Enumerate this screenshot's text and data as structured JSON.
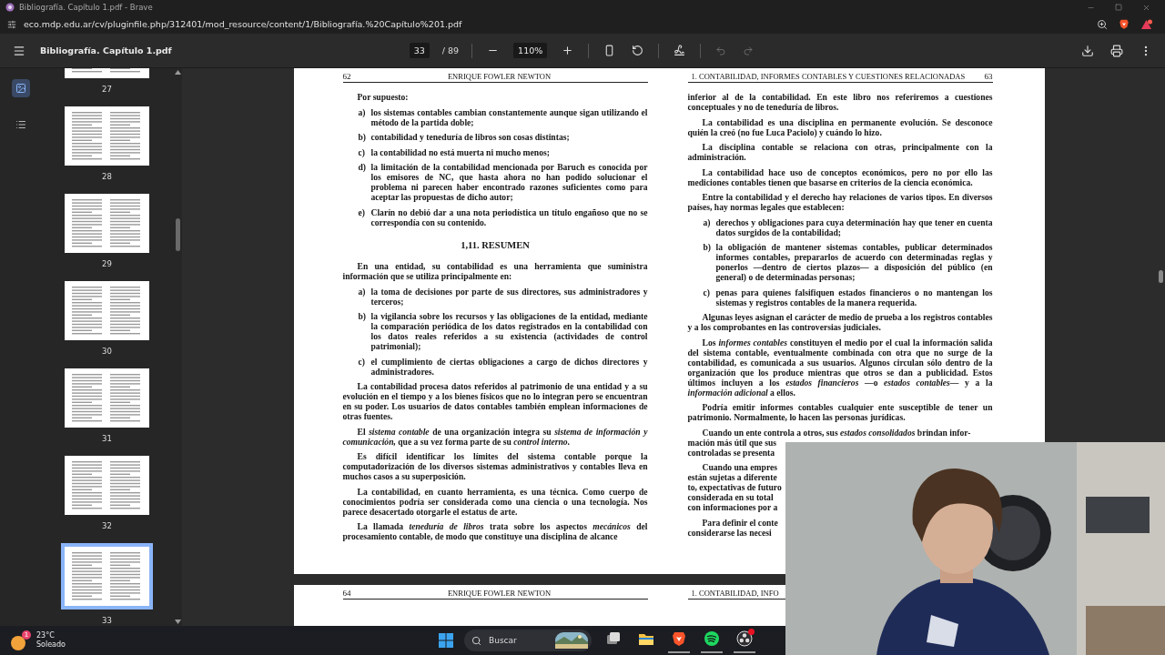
{
  "browser": {
    "title": "Bibliografía. Capítulo 1.pdf - Brave",
    "url": "eco.mdp.edu.ar/cv/pluginfile.php/312401/mod_resource/content/1/Bibliografía.%20Capítulo%201.pdf"
  },
  "toolbar": {
    "file_name": "Bibliografía. Capítulo 1.pdf",
    "page": "33",
    "page_total": "/ 89",
    "zoom": "110%",
    "history": [
      {
        "kind": "undo",
        "disabled": true
      },
      {
        "kind": "redo",
        "disabled": true
      }
    ]
  },
  "sidebar": {
    "tabs": [
      {
        "kind": "thumbnails",
        "selected": true
      },
      {
        "kind": "outline",
        "selected": false
      }
    ],
    "thumbnails": [
      {
        "label": "27",
        "selected": false
      },
      {
        "label": "28",
        "selected": false
      },
      {
        "label": "29",
        "selected": false
      },
      {
        "label": "30",
        "selected": false
      },
      {
        "label": "31",
        "selected": false
      },
      {
        "label": "32",
        "selected": false
      },
      {
        "label": "33",
        "selected": true
      }
    ]
  },
  "sheets": [
    {
      "left": {
        "number": "62",
        "header": "ENRIQUE FOWLER NEWTON",
        "blocks": [
          {
            "kind": "para",
            "text": "Por supuesto:"
          },
          {
            "kind": "item",
            "label": "a)",
            "text": "los sistemas contables cambian constantemente aunque sigan utilizando el método de la partida doble;"
          },
          {
            "kind": "item",
            "label": "b)",
            "text": "contabilidad y teneduría de libros son cosas distintas;"
          },
          {
            "kind": "item",
            "label": "c)",
            "text": "la contabilidad no está muerta ni mucho menos;"
          },
          {
            "kind": "item",
            "label": "d)",
            "text": "la limitación de la contabilidad mencionada por Baruch es conocida por los emisores de NC, que hasta ahora no han podido solucionar el problema ni parecen haber encontrado razones suficientes como para aceptar las propuestas de dicho autor;"
          },
          {
            "kind": "item",
            "label": "e)",
            "text": "Clarín no debió dar a una nota periodística un título engañoso que no se correspondía con su contenido."
          },
          {
            "kind": "heading",
            "text": "1,11. RESUMEN"
          },
          {
            "kind": "para",
            "text": "En una entidad, su contabilidad es una herramienta que suministra información que se utiliza principalmente en:"
          },
          {
            "kind": "item",
            "label": "a)",
            "text": "la toma de decisiones por parte de sus directores, sus administradores y terceros;"
          },
          {
            "kind": "item",
            "label": "b)",
            "text": "la vigilancia sobre los recursos y las obligaciones de la entidad, mediante la comparación periódica de los datos registrados en la contabilidad con los datos reales referidos a su existencia (actividades de control patrimonial);"
          },
          {
            "kind": "item",
            "label": "c)",
            "text": "el cumplimiento de ciertas obligaciones a cargo de dichos directores y administradores."
          },
          {
            "kind": "para",
            "text": "La contabilidad procesa datos referidos al patrimonio de una entidad y a su evolución en el tiempo y a los bienes físicos que no lo integran pero se encuentran en su poder. Los usuarios de datos contables también emplean informaciones de otras fuentes."
          },
          {
            "kind": "para",
            "text": "El *sistema contable* de una organización integra su *sistema de información y comunicación,* que a su vez forma parte de su *control interno*."
          },
          {
            "kind": "para",
            "text": "Es difícil identificar los límites del sistema contable porque la computadorización de los diversos sistemas administrativos y contables lleva en muchos casos a su superposición."
          },
          {
            "kind": "para",
            "text": "La contabilidad, en cuanto herramienta, es una técnica. Como cuerpo de conocimientos podría ser considerada como una ciencia o una tecnología. Nos parece desacertado otorgarle el estatus de arte."
          },
          {
            "kind": "para",
            "text": "La llamada *teneduría de libros* trata sobre los aspectos *mecánicos* del procesamiento contable, de modo que constituye una disciplina de alcance"
          }
        ]
      },
      "right": {
        "number": "63",
        "header": "1. CONTABILIDAD, INFORMES CONTABLES Y CUESTIONES RELACIONADAS",
        "blocks": [
          {
            "kind": "cont",
            "text": "inferior al de la contabilidad. En este libro nos referiremos a cuestiones conceptuales y no de teneduría de libros."
          },
          {
            "kind": "para",
            "text": "La contabilidad es una disciplina en permanente evolución. Se desconoce quién la creó (no fue Luca Paciolo) y cuándo lo hizo."
          },
          {
            "kind": "para",
            "text": "La disciplina contable se relaciona con otras, principalmente con la administración."
          },
          {
            "kind": "para",
            "text": "La contabilidad hace uso de conceptos económicos, pero no por ello las mediciones contables tienen que basarse en criterios de la ciencia económica."
          },
          {
            "kind": "para",
            "text": "Entre la contabilidad y el derecho hay relaciones de varios tipos. En diversos países, hay normas legales que establecen:"
          },
          {
            "kind": "item",
            "label": "a)",
            "text": "derechos y obligaciones para cuya determinación hay que tener en cuenta datos surgidos de la contabilidad;"
          },
          {
            "kind": "item",
            "label": "b)",
            "text": "la obligación de mantener sistemas contables, publicar determinados informes contables, prepararlos de acuerdo con determinadas reglas y ponerlos —dentro de ciertos plazos— a disposición del público (en general) o de determinadas personas;"
          },
          {
            "kind": "item",
            "label": "c)",
            "text": "penas para quienes falsifiquen estados financieros o no mantengan los sistemas y registros contables de la manera requerida."
          },
          {
            "kind": "para",
            "text": "Algunas leyes asignan el carácter de medio de prueba a los registros contables y a los comprobantes en las controversias judiciales."
          },
          {
            "kind": "para",
            "text": "Los *informes contables* constituyen el medio por el cual la información salida del sistema contable, eventualmente combinada con otra que no surge de la contabilidad, es comunicada a sus usuarios. Algunos circulan sólo dentro de la organización que los produce mientras que otros se dan a publicidad. Estos últimos incluyen a los *estados financieros* —o *estados contables*— y a la *información adicional* a ellos."
          },
          {
            "kind": "para",
            "text": "Podría emitir informes contables cualquier ente susceptible de tener un patrimonio. Normalmente, lo hacen las personas jurídicas."
          },
          {
            "kind": "cut",
            "lines": [
              "Cuando un ente controla a otros, sus *estados consolidados* brindan infor-",
              "mación más útil que sus",
              "controladas se presenta"
            ]
          },
          {
            "kind": "cut",
            "lines": [
              "Cuando una empres",
              "están sujetas a diferente",
              "to, expectativas de futuro",
              "considerada en su total",
              "con informaciones por a"
            ]
          },
          {
            "kind": "cut",
            "lines": [
              "Para definir el conte",
              "considerarse las necesi"
            ]
          }
        ]
      }
    },
    {
      "left": {
        "number": "64",
        "header": "ENRIQUE FOWLER NEWTON"
      },
      "right": {
        "header": "1. CONTABILIDAD, INFO"
      }
    }
  ],
  "taskbar": {
    "weather": {
      "temperature": "23°C",
      "condition": "Soleado",
      "badge": "1"
    },
    "search": {
      "placeholder": "Buscar"
    },
    "apps": [
      {
        "kind": "task-view",
        "running": false,
        "alert": false
      },
      {
        "kind": "files",
        "running": false,
        "alert": false
      },
      {
        "kind": "browser",
        "running": true,
        "alert": false
      },
      {
        "kind": "music",
        "running": true,
        "alert": false
      },
      {
        "kind": "recorder",
        "running": true,
        "alert": true
      }
    ]
  }
}
